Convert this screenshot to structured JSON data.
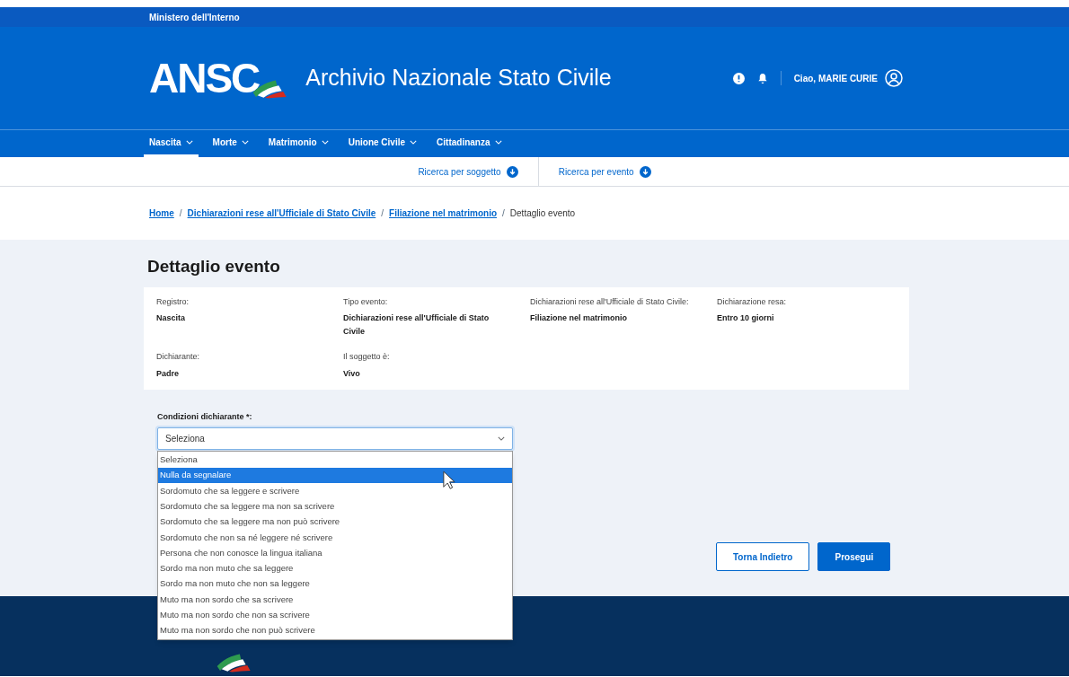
{
  "top_bar": {
    "text": "Ministero dell'Interno"
  },
  "header": {
    "logo": "ANSC",
    "title": "Archivio Nazionale Stato Civile",
    "greeting": "Ciao,",
    "user": "MARIE CURIE"
  },
  "nav": [
    {
      "label": "Nascita",
      "selected": true
    },
    {
      "label": "Morte",
      "selected": false
    },
    {
      "label": "Matrimonio",
      "selected": false
    },
    {
      "label": "Unione Civile",
      "selected": false
    },
    {
      "label": "Cittadinanza",
      "selected": false
    }
  ],
  "subnav": [
    "Ricerca per soggetto",
    "Ricerca per evento"
  ],
  "breadcrumb_separator": "/",
  "breadcrumb": [
    {
      "label": "Home",
      "link": true
    },
    {
      "label": "Dichiarazioni rese all'Ufficiale di Stato Civile",
      "link": true
    },
    {
      "label": "Filiazione nel matrimonio",
      "link": true
    },
    {
      "label": "Dettaglio evento",
      "link": false
    }
  ],
  "page_title": "Dettaglio evento",
  "details": [
    [
      {
        "label": "Registro:",
        "value": "Nascita"
      },
      {
        "label": "Tipo evento:",
        "value": "Dichiarazioni rese all'Ufficiale di Stato Civile"
      },
      {
        "label": "Dichiarazioni rese all'Ufficiale di Stato Civile:",
        "value": "Filiazione nel matrimonio"
      },
      {
        "label": "Dichiarazione resa:",
        "value": "Entro 10 giorni"
      }
    ],
    [
      {
        "label": "Dichiarante:",
        "value": "Padre"
      },
      {
        "label": "Il soggetto è:",
        "value": "Vivo"
      }
    ]
  ],
  "select": {
    "label": "Condizioni dichiarante *:",
    "value": "Seleziona",
    "expanded": true,
    "options": [
      {
        "label": "Seleziona",
        "highlighted": false
      },
      {
        "label": "Nulla da segnalare",
        "highlighted": true
      },
      {
        "label": "Sordomuto che sa leggere e scrivere",
        "highlighted": false
      },
      {
        "label": "Sordomuto che sa leggere ma non sa scrivere",
        "highlighted": false
      },
      {
        "label": "Sordomuto che sa leggere ma non può scrivere",
        "highlighted": false
      },
      {
        "label": "Sordomuto che non sa né leggere né scrivere",
        "highlighted": false
      },
      {
        "label": "Persona che non conosce la lingua italiana",
        "highlighted": false
      },
      {
        "label": "Sordo ma non muto che sa leggere",
        "highlighted": false
      },
      {
        "label": "Sordo ma non muto che non sa leggere",
        "highlighted": false
      },
      {
        "label": "Muto ma non sordo che sa scrivere",
        "highlighted": false
      },
      {
        "label": "Muto ma non sordo che non sa scrivere",
        "highlighted": false
      },
      {
        "label": "Muto ma non sordo che non può scrivere",
        "highlighted": false
      }
    ]
  },
  "buttons": [
    {
      "label": "Torna Indietro",
      "kind": "secondary"
    },
    {
      "label": "Prosegui",
      "kind": "primary"
    }
  ]
}
